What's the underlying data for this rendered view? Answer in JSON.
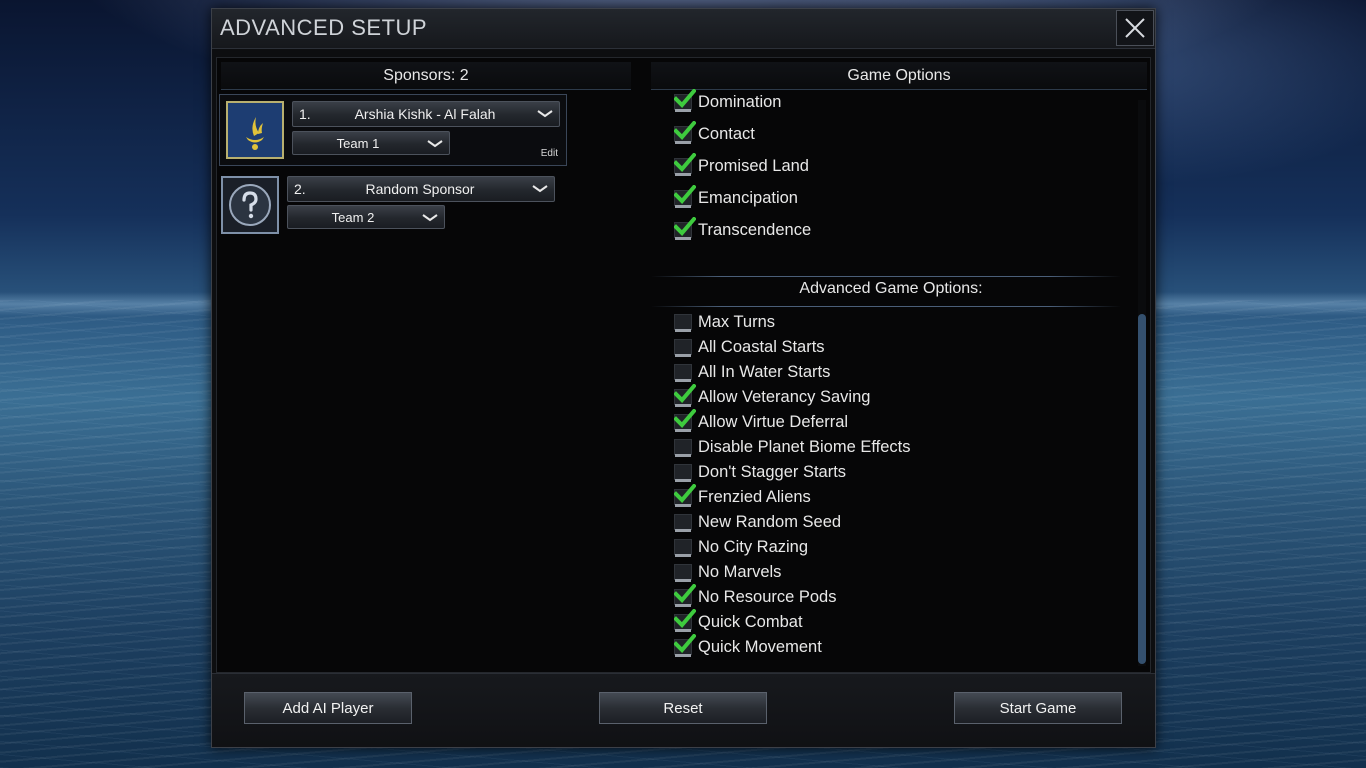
{
  "window": {
    "title": "ADVANCED SETUP"
  },
  "sponsors": {
    "header": "Sponsors: 2",
    "list": [
      {
        "num": "1.",
        "name": "Arshia Kishk - Al Falah",
        "team": "Team 1",
        "edit": "Edit"
      },
      {
        "num": "2.",
        "name": "Random Sponsor",
        "team": "Team 2"
      }
    ]
  },
  "game_options": {
    "header": "Game Options",
    "items": [
      {
        "label": "Domination",
        "checked": true
      },
      {
        "label": "Contact",
        "checked": true
      },
      {
        "label": "Promised Land",
        "checked": true
      },
      {
        "label": "Emancipation",
        "checked": true
      },
      {
        "label": "Transcendence",
        "checked": true
      }
    ]
  },
  "advanced_options": {
    "header": "Advanced Game Options:",
    "items": [
      {
        "label": "Max Turns",
        "checked": false
      },
      {
        "label": "All Coastal Starts",
        "checked": false
      },
      {
        "label": "All In Water Starts",
        "checked": false
      },
      {
        "label": "Allow Veterancy Saving",
        "checked": true
      },
      {
        "label": "Allow Virtue Deferral",
        "checked": true
      },
      {
        "label": "Disable Planet Biome Effects",
        "checked": false
      },
      {
        "label": "Don't Stagger Starts",
        "checked": false
      },
      {
        "label": "Frenzied Aliens",
        "checked": true
      },
      {
        "label": "New Random Seed",
        "checked": false
      },
      {
        "label": "No City Razing",
        "checked": false
      },
      {
        "label": "No Marvels",
        "checked": false
      },
      {
        "label": "No Resource Pods",
        "checked": true
      },
      {
        "label": "Quick Combat",
        "checked": true
      },
      {
        "label": "Quick Movement",
        "checked": true
      }
    ]
  },
  "footer": {
    "add_ai": "Add AI Player",
    "reset": "Reset",
    "start": "Start Game"
  },
  "colors": {
    "check": "#3ecb3e",
    "panel": "#0d0e10",
    "accent": "#34506e"
  }
}
